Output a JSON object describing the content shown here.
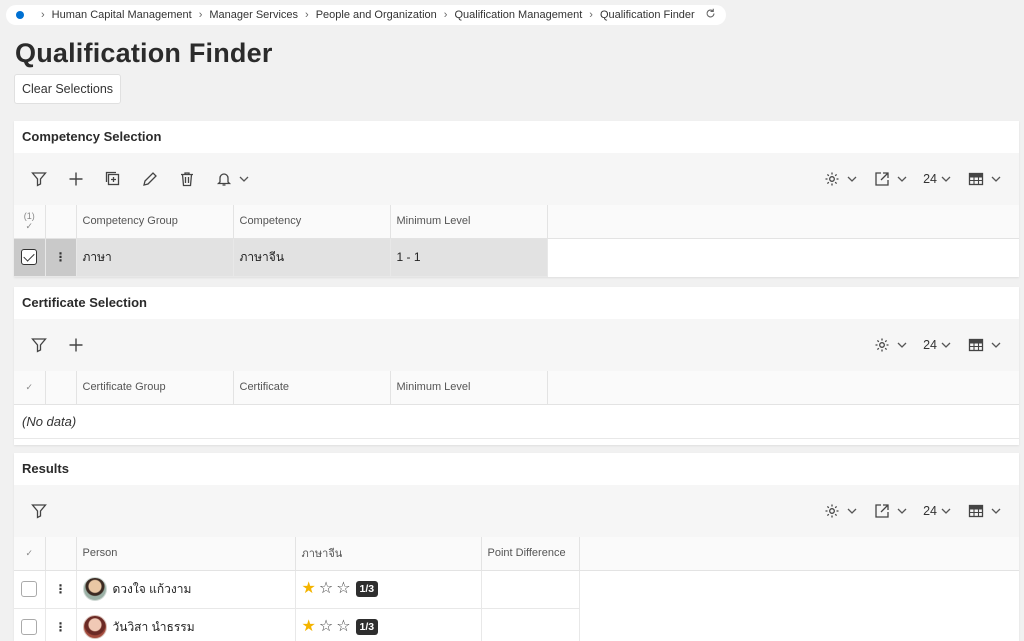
{
  "breadcrumb": {
    "items": [
      "Human Capital Management",
      "Manager Services",
      "People and Organization",
      "Qualification Management",
      "Qualification Finder"
    ]
  },
  "page": {
    "title": "Qualification Finder",
    "clear_label": "Clear Selections"
  },
  "competency": {
    "title": "Competency Selection",
    "page_size": "24",
    "selected_count": "(1)",
    "columns": [
      "Competency Group",
      "Competency",
      "Minimum Level"
    ],
    "rows": [
      {
        "group": "ภาษา",
        "competency": "ภาษาจีน",
        "level": "1 - 1",
        "selected": true
      }
    ]
  },
  "certificate": {
    "title": "Certificate Selection",
    "page_size": "24",
    "columns": [
      "Certificate Group",
      "Certificate",
      "Minimum Level"
    ],
    "empty_text": "(No data)"
  },
  "results": {
    "title": "Results",
    "page_size": "24",
    "columns": [
      "Person",
      "ภาษาจีน",
      "Point Difference"
    ],
    "rows": [
      {
        "person": "ดวงใจ แก้วงาม",
        "rating": 1,
        "max": 3,
        "badge": "1/3"
      },
      {
        "person": "วันวิสา นำธรรม",
        "rating": 1,
        "max": 3,
        "badge": "1/3"
      }
    ]
  },
  "colors": {
    "accent": "#0070d2",
    "star": "#f4b400",
    "badge": "#2e2e2e"
  }
}
